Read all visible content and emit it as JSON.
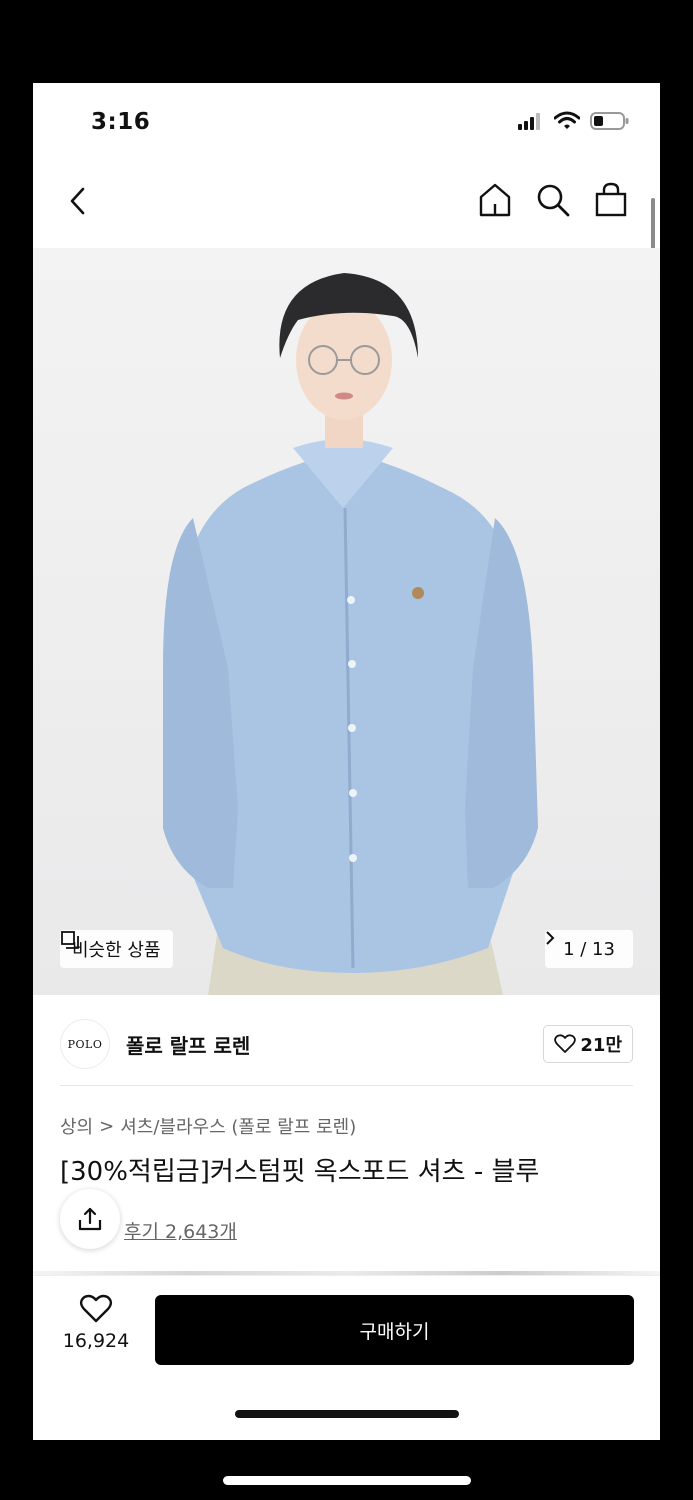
{
  "status_bar": {
    "time": "3:16"
  },
  "nav": {
    "back_icon": "chevron-left-icon",
    "icons": [
      "home-icon",
      "search-icon",
      "shopping-bag-icon"
    ]
  },
  "hero": {
    "similar_label": "비슷한 상품",
    "counter": "1 / 13"
  },
  "brand": {
    "logo_text": "POLO",
    "name": "폴로 랄프 로렌",
    "likes": "21만"
  },
  "breadcrumb": {
    "category": "상의",
    "separator": ">",
    "subcategory": "셔츠/블라우스 (폴로 랄프 로렌)"
  },
  "product": {
    "title": "[30%적립금]커스텀핏 옥스포드 셔츠 - 블루",
    "reviews": "후기 2,643개"
  },
  "bottom_bar": {
    "wish_count": "16,924",
    "buy_label": "구매하기"
  },
  "colors": {
    "accent": "#000000",
    "shirt": "#a9c3e3",
    "background": "#ffffff"
  }
}
